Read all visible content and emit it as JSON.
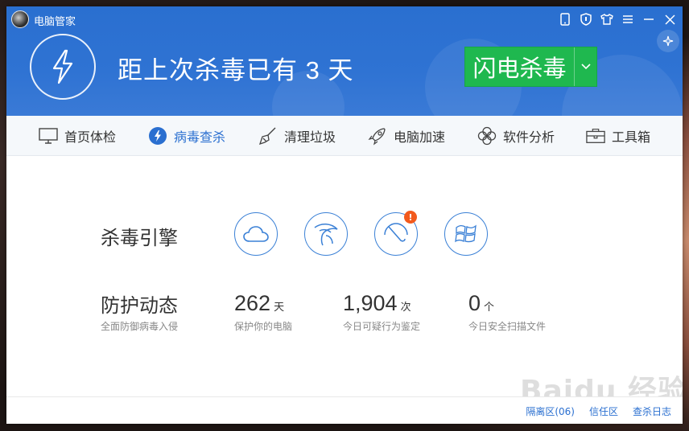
{
  "app": {
    "title": "电脑管家"
  },
  "header": {
    "headline": "距上次杀毒已有 3 天",
    "scan_button_label": "闪电杀毒"
  },
  "nav": {
    "items": [
      {
        "label": "首页体检",
        "icon": "monitor-icon"
      },
      {
        "label": "病毒查杀",
        "icon": "bolt-icon",
        "active": true
      },
      {
        "label": "清理垃圾",
        "icon": "broom-icon"
      },
      {
        "label": "电脑加速",
        "icon": "rocket-icon"
      },
      {
        "label": "软件分析",
        "icon": "clover-icon"
      },
      {
        "label": "工具箱",
        "icon": "toolbox-icon"
      }
    ]
  },
  "engines": {
    "label": "杀毒引擎",
    "icons": [
      "cloud-engine-icon",
      "eagle-engine-icon",
      "umbrella-engine-icon",
      "windows-engine-icon"
    ],
    "alert_badge": "!"
  },
  "protection": {
    "label": "防护动态",
    "sublabel": "全面防御病毒入侵",
    "stats": [
      {
        "value": "262",
        "unit": "天",
        "desc": "保护你的电脑"
      },
      {
        "value": "1,904",
        "unit": "次",
        "desc": "今日可疑行为鉴定"
      },
      {
        "value": "0",
        "unit": "个",
        "desc": "今日安全扫描文件"
      }
    ]
  },
  "footer": {
    "links": [
      "隔离区(06)",
      "信任区",
      "查杀日志"
    ]
  },
  "watermark": "Baidu 经验",
  "colors": {
    "header_blue": "#2a6fd0",
    "scan_green": "#1fb84f",
    "badge_orange": "#f25a1d"
  }
}
